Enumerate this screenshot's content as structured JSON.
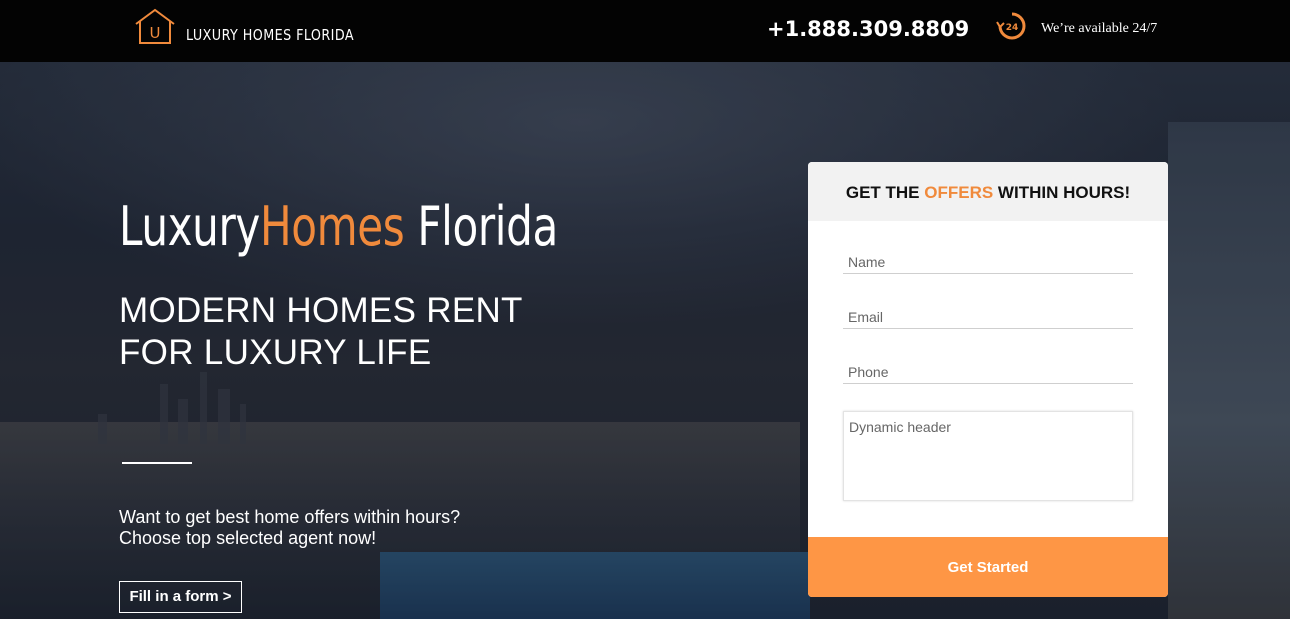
{
  "header": {
    "logo_text": "LUXURY HOMES FLORIDA",
    "phone": "+1.888.309.8809",
    "availability_text": "We’re available 24/7",
    "availability_icon_label": "24"
  },
  "hero": {
    "title_part1": "Luxury",
    "title_accent": "Homes",
    "title_part2": " Florida",
    "subheading_line1": "MODERN HOMES RENT",
    "subheading_line2": "FOR LUXURY LIFE",
    "tagline_line1": "Want to get best home offers within hours?",
    "tagline_line2": "Choose top selected agent now!",
    "cta_label": "Fill in a form >"
  },
  "form": {
    "heading_prefix": "GET THE ",
    "heading_accent": "OFFERS",
    "heading_suffix": " WITHIN HOURS!",
    "name_placeholder": "Name",
    "email_placeholder": "Email",
    "phone_placeholder": "Phone",
    "message_placeholder": "Dynamic header",
    "submit_label": "Get Started"
  },
  "colors": {
    "accent": "#f08a3c",
    "button": "#fe9645",
    "topbar": "#030303"
  }
}
